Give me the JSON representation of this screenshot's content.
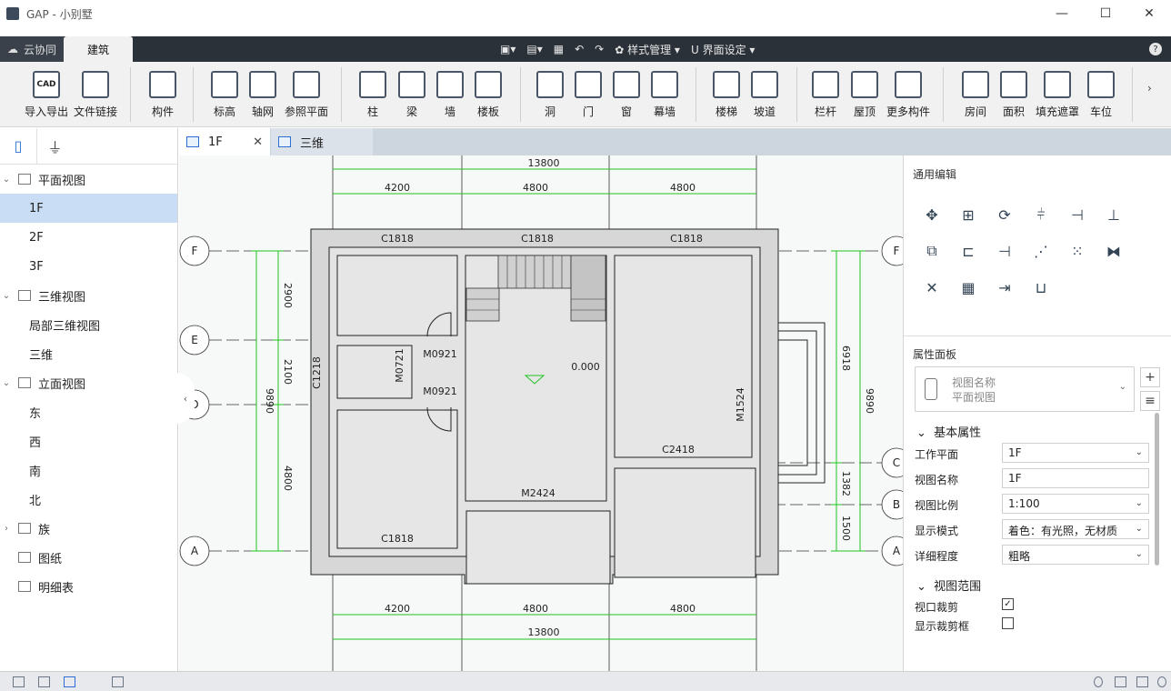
{
  "window": {
    "title": "GAP - 小别墅",
    "minimize": "—",
    "maximize": "☐",
    "close": "✕"
  },
  "topbar": {
    "cloud_tab": "云协同",
    "active_tab": "建筑",
    "style_mgmt": "样式管理",
    "ui_settings": "界面设定",
    "help": "?"
  },
  "ribbon": {
    "items": [
      "导入导出",
      "文件链接",
      "构件",
      "标高",
      "轴网",
      "参照平面",
      "柱",
      "梁",
      "墙",
      "楼板",
      "洞",
      "门",
      "窗",
      "幕墙",
      "楼梯",
      "坡道",
      "栏杆",
      "屋顶",
      "更多构件",
      "房间",
      "面积",
      "填充遮罩",
      "车位"
    ],
    "cad_label": "CAD"
  },
  "tree": [
    {
      "label": "平面视图",
      "level": 0,
      "expanded": true
    },
    {
      "label": "1F",
      "level": 1,
      "selected": true
    },
    {
      "label": "2F",
      "level": 1
    },
    {
      "label": "3F",
      "level": 1
    },
    {
      "label": "三维视图",
      "level": 0,
      "expanded": true
    },
    {
      "label": "局部三维视图",
      "level": 1
    },
    {
      "label": "三维",
      "level": 1
    },
    {
      "label": "立面视图",
      "level": 0,
      "expanded": true
    },
    {
      "label": "东",
      "level": 1
    },
    {
      "label": "西",
      "level": 1
    },
    {
      "label": "南",
      "level": 1
    },
    {
      "label": "北",
      "level": 1
    },
    {
      "label": "族",
      "level": 0,
      "expanded": false
    },
    {
      "label": "图纸",
      "level": 0
    },
    {
      "label": "明细表",
      "level": 0
    }
  ],
  "doc_tabs": [
    {
      "label": "1F",
      "active": true
    },
    {
      "label": "三维",
      "active": false
    }
  ],
  "drawing": {
    "top_total": "13800",
    "top_dims": [
      "4200",
      "4800",
      "4800"
    ],
    "bottom_total": "13800",
    "bottom_dims": [
      "4200",
      "4800",
      "4800"
    ],
    "axes_left": [
      "F",
      "E",
      "D",
      "A"
    ],
    "axes_right": [
      "F",
      "C",
      "B",
      "A"
    ],
    "left_outer": "9890",
    "left_dims": [
      "2900",
      "2100",
      "4800"
    ],
    "right_outer": "9890",
    "right_dims": [
      "6918",
      "1382",
      "1500"
    ],
    "windows_top": [
      "C1818",
      "C1818",
      "C1818"
    ],
    "c1218": "C1218",
    "m0721": "M0721",
    "m0921_a": "M0921",
    "m0921_b": "M0921",
    "elevation": "0.000",
    "m1524": "M1524",
    "c2418": "C2418",
    "m2424": "M2424",
    "c1818_bottom": "C1818"
  },
  "panel": {
    "general_edit": "通用编辑",
    "props_title": "属性面板",
    "view_type_1": "视图名称",
    "view_type_2": "平面视图",
    "group_basic": "基本属性",
    "rows": [
      {
        "key": "工作平面",
        "value": "1F",
        "dropdown": true
      },
      {
        "key": "视图名称",
        "value": "1F",
        "dropdown": false
      },
      {
        "key": "视图比例",
        "value": "1:100",
        "dropdown": true
      },
      {
        "key": "显示模式",
        "value": "着色：有光照，无材质",
        "dropdown": true
      },
      {
        "key": "详细程度",
        "value": "粗略",
        "dropdown": true
      }
    ],
    "group_range": "视图范围",
    "crop_label": "视口裁剪",
    "crop_checked": true,
    "show_crop_label": "显示裁剪框",
    "show_crop_checked": false
  }
}
